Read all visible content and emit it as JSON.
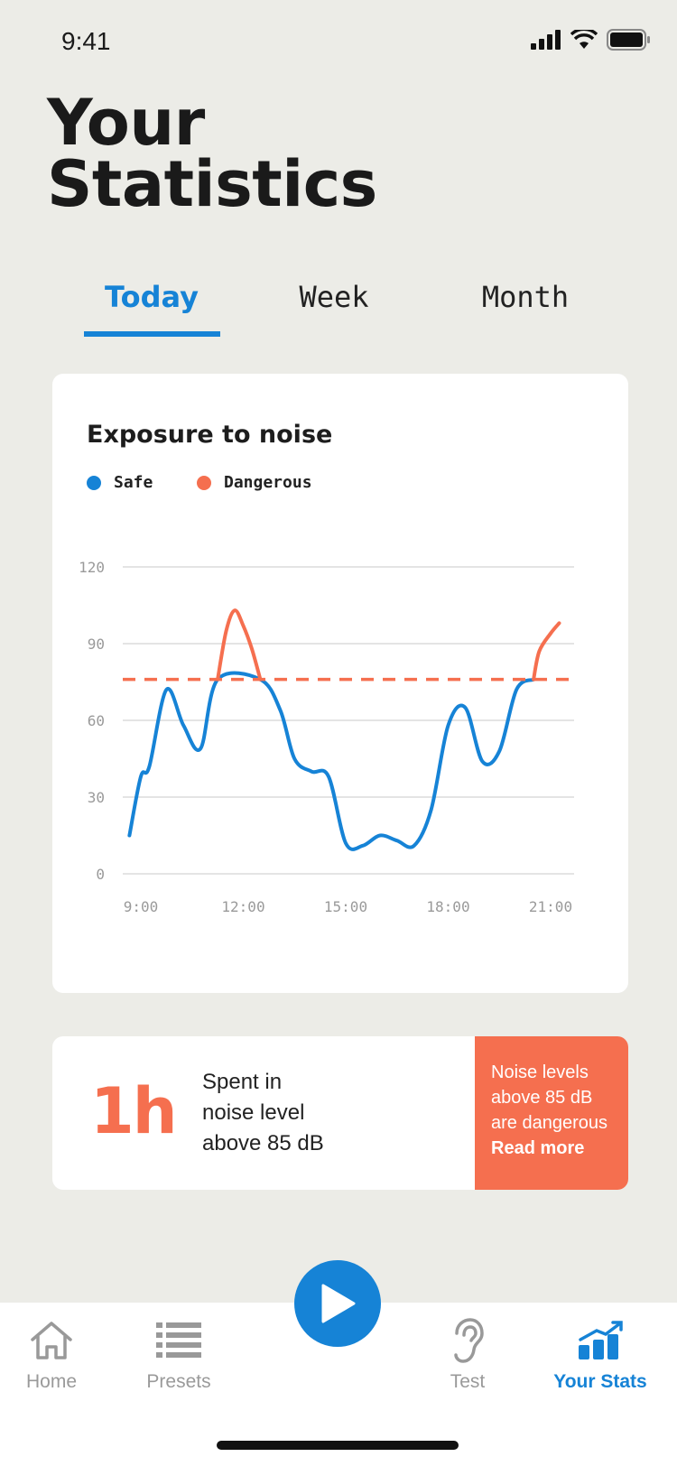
{
  "status": {
    "time": "9:41"
  },
  "page": {
    "title": "Your\nStatistics"
  },
  "tabs": [
    {
      "label": "Today",
      "active": true
    },
    {
      "label": "Week",
      "active": false
    },
    {
      "label": "Month",
      "active": false
    }
  ],
  "chart": {
    "title": "Exposure to noise",
    "legend": [
      {
        "label": "Safe",
        "color": "#1683D6"
      },
      {
        "label": "Dangerous",
        "color": "#F56F4F"
      }
    ]
  },
  "chart_data": {
    "type": "line",
    "title": "Exposure to noise",
    "xlabel": "",
    "ylabel": "",
    "x_ticks": [
      "9:00",
      "12:00",
      "15:00",
      "18:00",
      "21:00"
    ],
    "y_ticks": [
      0,
      30,
      60,
      90,
      120
    ],
    "ylim": [
      0,
      120
    ],
    "threshold": 76,
    "threshold_style": "dashed",
    "grid": true,
    "legend_position": "top-left",
    "series": [
      {
        "name": "Safe",
        "color": "#1683D6",
        "points": [
          [
            "8:40",
            15
          ],
          [
            "9:00",
            38
          ],
          [
            "9:15",
            42
          ],
          [
            "9:45",
            72
          ],
          [
            "10:15",
            58
          ],
          [
            "10:45",
            49
          ],
          [
            "11:15",
            76
          ],
          [
            "12:30",
            76
          ],
          [
            "13:05",
            64
          ],
          [
            "13:30",
            45
          ],
          [
            "14:00",
            40
          ],
          [
            "14:30",
            38
          ],
          [
            "15:00",
            12
          ],
          [
            "15:30",
            11
          ],
          [
            "16:00",
            15
          ],
          [
            "16:30",
            13
          ],
          [
            "17:00",
            11
          ],
          [
            "17:30",
            25
          ],
          [
            "18:00",
            58
          ],
          [
            "18:30",
            65
          ],
          [
            "19:00",
            44
          ],
          [
            "19:30",
            48
          ],
          [
            "20:00",
            72
          ],
          [
            "20:30",
            76
          ]
        ]
      },
      {
        "name": "Dangerous",
        "color": "#F56F4F",
        "points": [
          [
            "11:15",
            76
          ],
          [
            "11:30",
            95
          ],
          [
            "11:45",
            103
          ],
          [
            "12:00",
            97
          ],
          [
            "12:15",
            88
          ],
          [
            "12:30",
            76
          ],
          [
            "20:30",
            76
          ],
          [
            "20:40",
            87
          ],
          [
            "21:00",
            94
          ],
          [
            "21:15",
            98
          ]
        ]
      }
    ]
  },
  "info": {
    "big_value": "1h",
    "description": "Spent in\nnoise level\nabove 85 dB",
    "warning": "Noise levels\nabove 85 dB\nare dangerous",
    "read_more": "Read more"
  },
  "nav": {
    "items": [
      {
        "label": "Home",
        "icon": "home-icon",
        "active": false
      },
      {
        "label": "Presets",
        "icon": "list-icon",
        "active": false
      },
      {
        "label": "Test",
        "icon": "ear-icon",
        "active": false
      },
      {
        "label": "Your Stats",
        "icon": "stats-icon",
        "active": true
      }
    ],
    "play_icon": "play-icon"
  },
  "colors": {
    "accent": "#1683D6",
    "danger": "#F56F4F",
    "background": "#ECECE7"
  }
}
